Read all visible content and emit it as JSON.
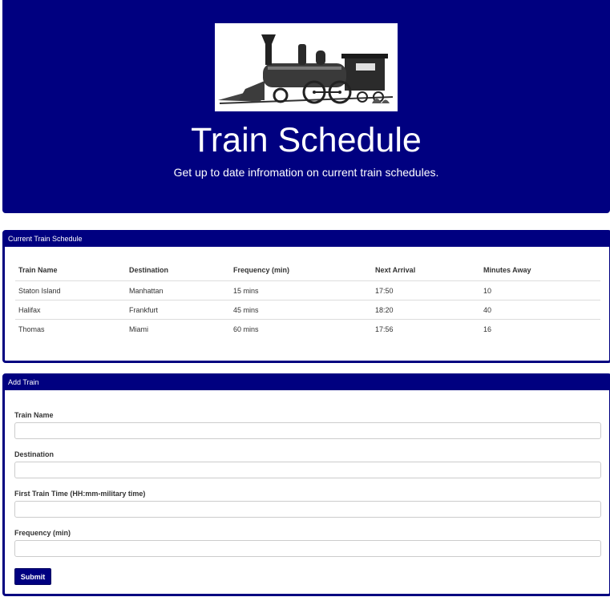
{
  "header": {
    "title": "Train Schedule",
    "subtitle": "Get up to date infromation on current train schedules.",
    "image_icon": "steam-locomotive-engraving"
  },
  "schedule": {
    "heading": "Current Train Schedule",
    "columns": [
      "Train Name",
      "Destination",
      "Frequency (min)",
      "Next Arrival",
      "Minutes Away"
    ],
    "rows": [
      [
        "Staton Island",
        "Manhattan",
        "15 mins",
        "17:50",
        "10"
      ],
      [
        "Halifax",
        "Frankfurt",
        "45 mins",
        "18:20",
        "40"
      ],
      [
        "Thomas",
        "Miami",
        "60 mins",
        "17:56",
        "16"
      ]
    ]
  },
  "form": {
    "heading": "Add Train",
    "train_name_label": "Train Name",
    "destination_label": "Destination",
    "first_time_label": "First Train Time (HH:mm-military time)",
    "frequency_label": "Frequency (min)",
    "train_name_value": "",
    "destination_value": "",
    "first_time_value": "",
    "frequency_value": "",
    "submit_label": "Submit"
  },
  "colors": {
    "primary": "#000080",
    "background": "#ffffff"
  }
}
